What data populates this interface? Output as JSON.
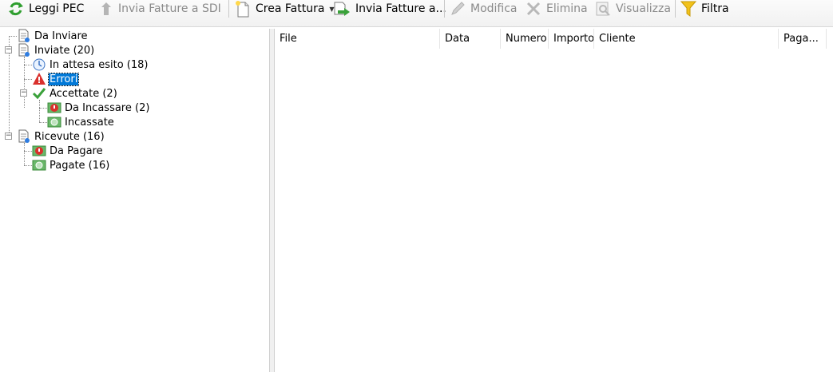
{
  "toolbar": {
    "leggi_pec": "Leggi PEC",
    "invia_sdi": "Invia Fatture a SDI",
    "crea_fattura": "Crea Fattura",
    "invia_fatture": "Invia Fatture a...",
    "modifica": "Modifica",
    "elimina": "Elimina",
    "visualizza": "Visualizza",
    "filtra": "Filtra"
  },
  "tree": {
    "da_inviare": "Da Inviare",
    "inviate": "Inviate (20)",
    "in_attesa": "In attesa esito (18)",
    "errori": "Errori",
    "accettate": "Accettate (2)",
    "da_incassare": "Da Incassare (2)",
    "incassate": "Incassate",
    "ricevute": "Ricevute (16)",
    "da_pagare": "Da Pagare",
    "pagate": "Pagate (16)"
  },
  "list": {
    "columns": [
      "File",
      "Data",
      "Numero",
      "Importo",
      "Cliente",
      "Paga..."
    ]
  },
  "colors": {
    "selection": "#0078d7",
    "accent_green": "#3aa13a",
    "error_red": "#d9302c"
  }
}
